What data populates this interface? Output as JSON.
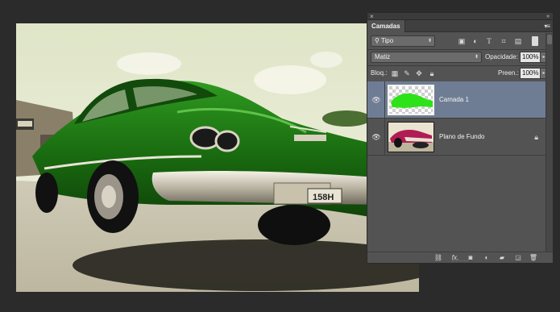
{
  "panel": {
    "close_glyph": "×",
    "collapse_glyph": "»",
    "tab_label": "Camadas",
    "menu_glyph": "▾≡"
  },
  "filter": {
    "kind_value": "Tipo",
    "icons": [
      "image-filter-icon",
      "adjustment-filter-icon",
      "type-filter-icon",
      "shape-filter-icon",
      "smart-object-filter-icon"
    ]
  },
  "blend": {
    "mode_value": "Matiz",
    "opacity_label": "Opacidade:",
    "opacity_value": "100%"
  },
  "lock": {
    "label": "Bloq.:",
    "icons": [
      "lock-transparent-pixels-icon",
      "lock-image-pixels-icon",
      "lock-position-icon",
      "lock-all-icon"
    ],
    "fill_label": "Preen.:",
    "fill_value": "100%"
  },
  "layers": [
    {
      "name": "Camada 1",
      "selected": true,
      "visible": true,
      "locked": false
    },
    {
      "name": "Plano de Fundo",
      "selected": false,
      "visible": true,
      "locked": true
    }
  ],
  "footer_buttons": [
    "link-layers-icon",
    "fx-icon",
    "layer-mask-icon",
    "adjustment-layer-icon",
    "new-group-icon",
    "new-layer-icon",
    "delete-layer-icon"
  ],
  "fx_label": "fx.",
  "colors": {
    "panel_bg": "#535353",
    "selected_layer": "#6f7d94",
    "workspace_bg": "#2b2b2b",
    "car_green": "#1c7a12"
  }
}
